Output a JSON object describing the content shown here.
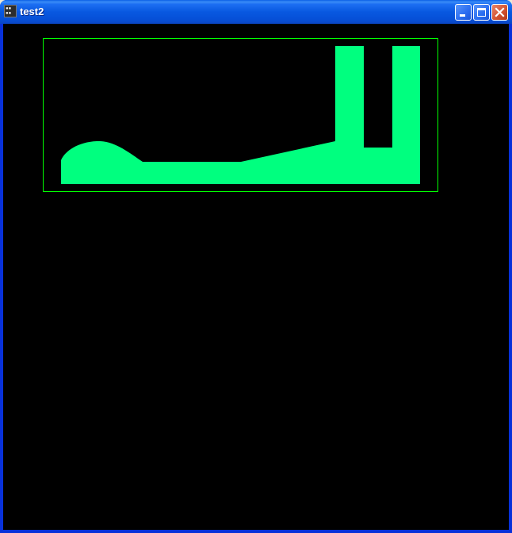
{
  "window": {
    "title": "test2",
    "icon": "app-icon",
    "controls": [
      "minimize-icon",
      "maximize-icon",
      "close-icon"
    ]
  },
  "canvas": {
    "background": "#000000",
    "frame_color": "#00ff00",
    "shape_color": "#00ff7f"
  }
}
